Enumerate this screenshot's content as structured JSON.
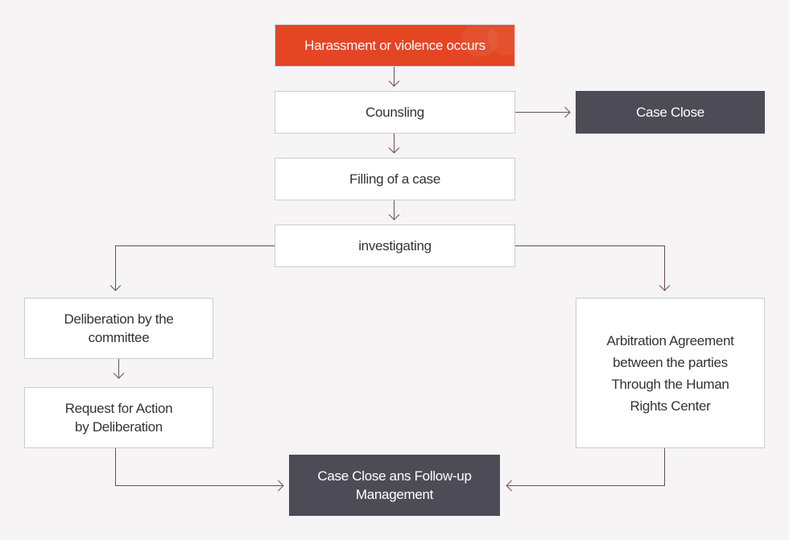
{
  "nodes": {
    "start": "Harassment or violence occurs",
    "counseling": "Counsling",
    "case_close": "Case Close",
    "filing": "Filling of a case",
    "investigating": "investigating",
    "deliberation": "Deliberation by the committee",
    "request": "Request for Action by Deliberation",
    "arbitration": "Arbitration Agreement between the parties Through the Human Rights Center",
    "final": "Case Close ans Follow-up Management"
  },
  "colors": {
    "start": "#e44623",
    "terminal": "#4c4b56",
    "connector": "#6b4f55",
    "border": "#c8ccd4",
    "background": "#f6f4f4"
  }
}
